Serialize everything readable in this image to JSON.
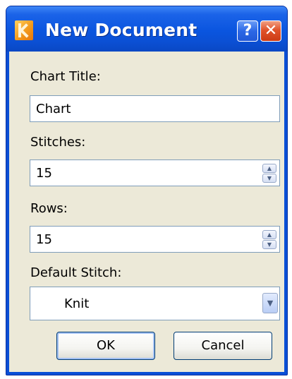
{
  "dialog": {
    "title": "New Document",
    "help_label": "?",
    "close_label": "✕"
  },
  "form": {
    "chart_title_label": "Chart Title:",
    "chart_title_value": "Chart",
    "stitches_label": "Stitches:",
    "stitches_value": "15",
    "rows_label": "Rows:",
    "rows_value": "15",
    "default_stitch_label": "Default Stitch:",
    "default_stitch_value": "Knit"
  },
  "buttons": {
    "ok_label": "OK",
    "cancel_label": "Cancel"
  },
  "icons": {
    "app": "app-logo-icon",
    "help": "help-icon",
    "close": "close-icon",
    "spin_up": "arrow-up-icon",
    "spin_down": "arrow-down-icon",
    "dropdown": "chevron-down-icon"
  },
  "colors": {
    "titlebar": "#0a55df",
    "client_bg": "#ece9d8",
    "close_button": "#e0532a",
    "field_border": "#7f9db9"
  }
}
